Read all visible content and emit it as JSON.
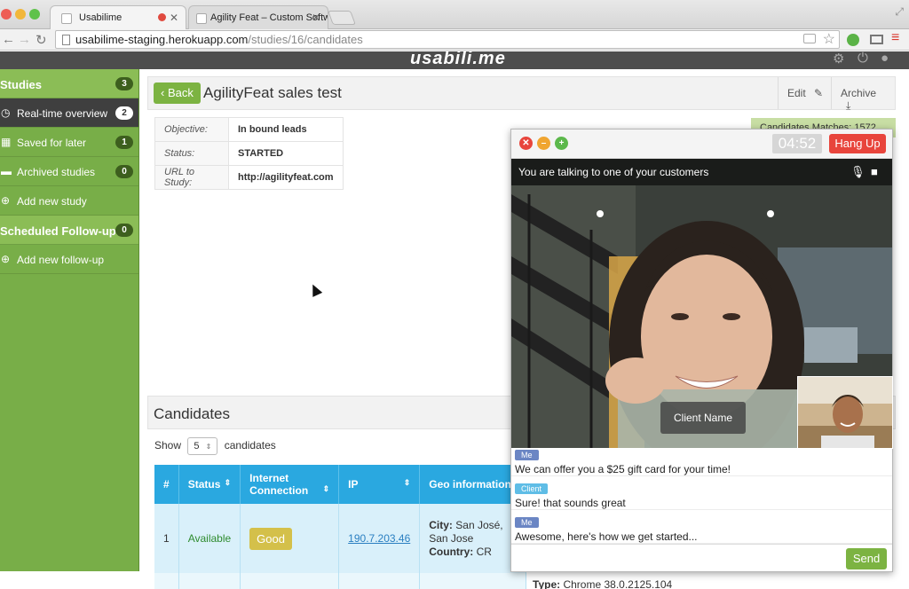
{
  "browser": {
    "tabs": [
      {
        "title": "Usabilime"
      },
      {
        "title": "Agility Feat – Custom Softw"
      }
    ],
    "url_host": "usabilime-staging.herokuapp.com",
    "url_path": "/studies/16/candidates"
  },
  "app": {
    "logo": "usabili.me"
  },
  "sidebar": {
    "studies_label": "Studies",
    "studies_count": "3",
    "items": [
      {
        "label": "Real-time overview",
        "count": "2"
      },
      {
        "label": "Saved for later",
        "count": "1"
      },
      {
        "label": "Archived studies",
        "count": "0"
      },
      {
        "label": "Add new study"
      }
    ],
    "followups_label": "Scheduled Follow-ups",
    "followups_count": "0",
    "add_followup": "Add new follow-up"
  },
  "study": {
    "back_label": "Back",
    "title": "AgilityFeat sales test",
    "edit_label": "Edit",
    "archive_label": "Archive",
    "fields": [
      {
        "key": "Objective:",
        "value": "In bound leads"
      },
      {
        "key": "Status:",
        "value": "STARTED"
      },
      {
        "key": "URL to Study:",
        "value": "http://agilityfeat.com"
      }
    ],
    "matches": "Candidates Matches: 1572"
  },
  "candidates": {
    "title": "Candidates",
    "show_label": "Show",
    "show_value": "5",
    "show_suffix": "candidates",
    "columns": [
      "#",
      "Status",
      "Internet Connection",
      "IP",
      "Geo information"
    ],
    "rows": [
      {
        "num": "1",
        "status": "Available",
        "connection": "Good",
        "ip": "190.7.203.46",
        "city_label": "City:",
        "city": "San José, San Jose",
        "country_label": "Country:",
        "country": "CR"
      }
    ],
    "next_row_type_label": "Type:",
    "next_row_type": "Chrome 38.0.2125.104"
  },
  "call": {
    "timer": "04:52",
    "hangup_label": "Hang Up",
    "banner": "You are talking to one of your customers",
    "client_name": "Client Name",
    "messages": [
      {
        "who": "Me",
        "text": "We can offer you a $25 gift card for your time!"
      },
      {
        "who": "Client",
        "text": "Sure! that sounds great"
      },
      {
        "who": "Me",
        "text": "Awesome, here's how we get started..."
      }
    ],
    "send_label": "Send"
  }
}
